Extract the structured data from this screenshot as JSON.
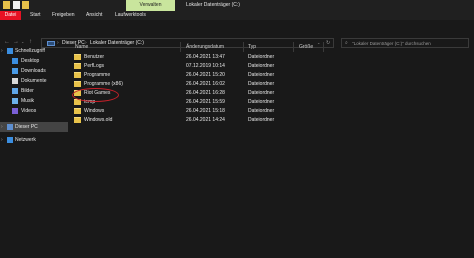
{
  "window": {
    "title": "Lokaler Datenträger (C:)",
    "contextual_tab": "Verwalten"
  },
  "ribbon": {
    "tabs": [
      "Datei",
      "Start",
      "Freigeben",
      "Ansicht",
      "Laufwerktools"
    ]
  },
  "address": {
    "crumbs": [
      "Dieser PC",
      "Lokaler Datenträger (C:)"
    ],
    "search_placeholder": "\"Lokaler Datenträger (C:)\" durchsuchen"
  },
  "columns": [
    "Name",
    "Änderungsdatum",
    "Typ",
    "Größe"
  ],
  "files": [
    {
      "name": "Benutzer",
      "date": "26.04.2021 13:47",
      "type": "Dateiordner"
    },
    {
      "name": "PerfLogs",
      "date": "07.12.2019 10:14",
      "type": "Dateiordner"
    },
    {
      "name": "Programme",
      "date": "26.04.2021 15:20",
      "type": "Dateiordner"
    },
    {
      "name": "Programme (x86)",
      "date": "26.04.2021 16:02",
      "type": "Dateiordner"
    },
    {
      "name": "Riot Games",
      "date": "26.04.2021 16:28",
      "type": "Dateiordner"
    },
    {
      "name": "temp",
      "date": "26.04.2021 15:59",
      "type": "Dateiordner"
    },
    {
      "name": "Windows",
      "date": "26.04.2021 15:18",
      "type": "Dateiordner"
    },
    {
      "name": "Windows.old",
      "date": "26.04.2021 14:24",
      "type": "Dateiordner"
    }
  ],
  "nav": {
    "quick_access": "Schnellzugriff",
    "items": [
      "Desktop",
      "Downloads",
      "Dokumente",
      "Bilder",
      "Musik",
      "Videos"
    ],
    "this_pc": "Dieser PC",
    "network": "Netzwerk"
  },
  "colors": {
    "datei_tab": "#e81123",
    "verwalten_tab": "#c9e59d",
    "highlight_circle": "#c8202a",
    "folder": "#e8c24a"
  }
}
